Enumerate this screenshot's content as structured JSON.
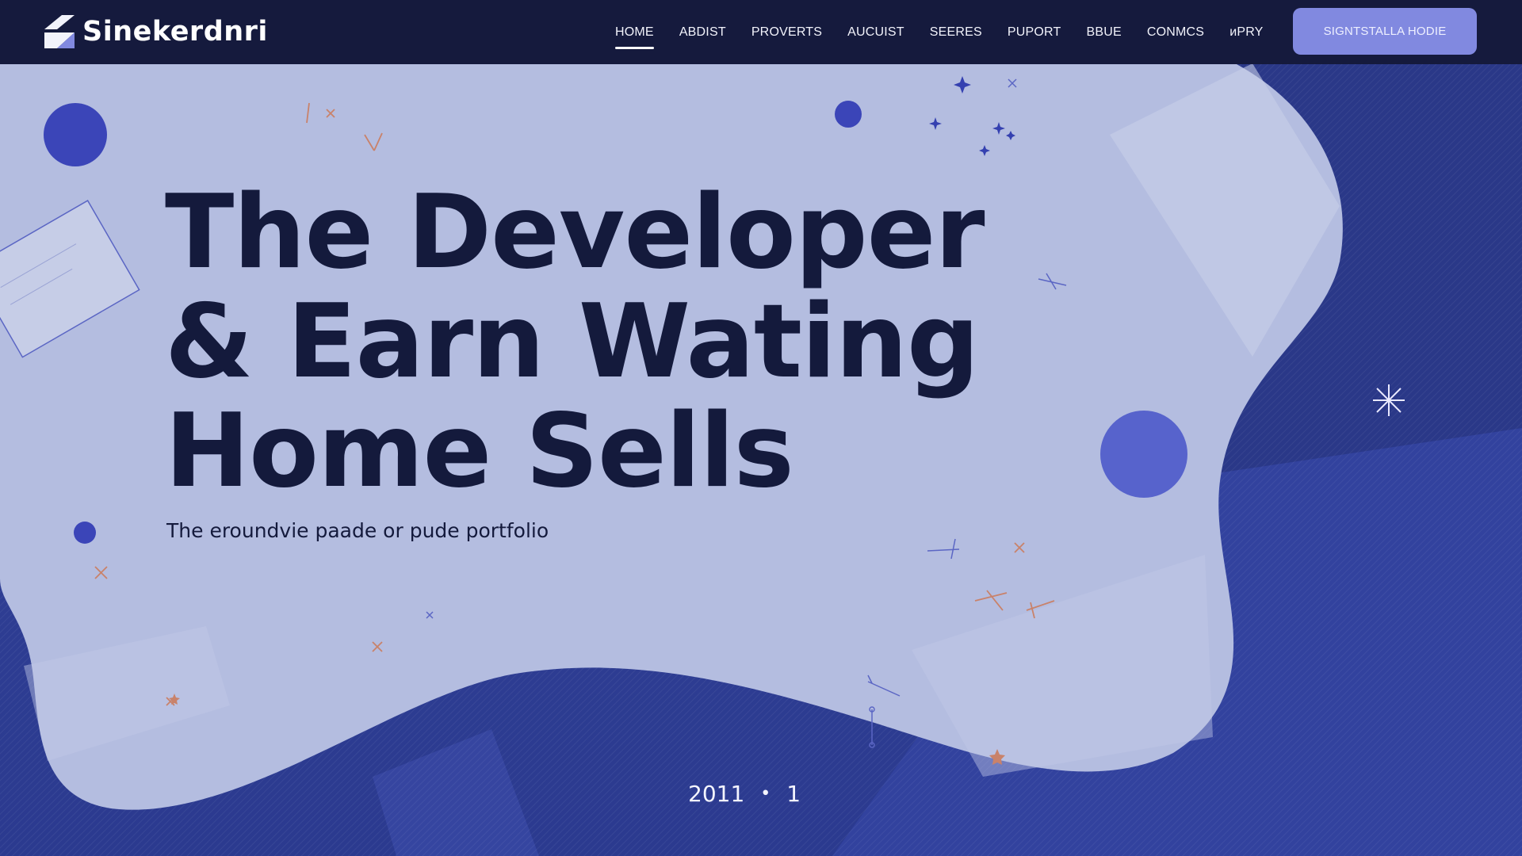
{
  "brand": {
    "name": "Sinekerdnri"
  },
  "nav": {
    "items": [
      {
        "label": "HOME",
        "active": true
      },
      {
        "label": "ABDIST",
        "active": false
      },
      {
        "label": "PROVERTS",
        "active": false
      },
      {
        "label": "AUCUIST",
        "active": false
      },
      {
        "label": "SEERES",
        "active": false
      },
      {
        "label": "PUPORT",
        "active": false
      },
      {
        "label": "BBUE",
        "active": false
      },
      {
        "label": "CONMCS",
        "active": false
      },
      {
        "label": "ᴎPRY",
        "active": false
      }
    ],
    "cta_label": "SIGNTSTALLA HODIE"
  },
  "hero": {
    "headline_lines": [
      "The Developer",
      "& Earn Wating",
      "Home Sells"
    ],
    "subtitle": "The eroundvie paade or pude portfolio"
  },
  "pager": {
    "year": "2011",
    "separator": "•",
    "page": "1"
  },
  "colors": {
    "nav_bg": "#151a3d",
    "cta_bg": "#8189e0",
    "blob": "#b4bde0",
    "deep_blue": "#2f3e94",
    "accent_circle": "#3b45b8",
    "headline": "#141a3c"
  },
  "icons": [
    "logo-mark-icon",
    "sparkle-icon",
    "circle-decoration"
  ]
}
